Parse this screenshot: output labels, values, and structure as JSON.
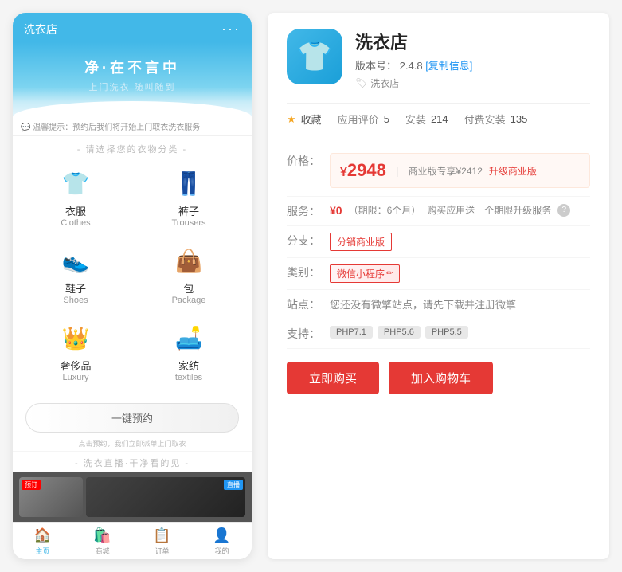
{
  "phone": {
    "title": "洗衣店",
    "dots": "···",
    "banner": {
      "tagline_main": "净·在不言中",
      "tagline_sub": "上门洗衣 随叫随到"
    },
    "notice": "💬 温馨提示：预约后我们将开始上门取衣洗衣服务",
    "section_categories": "- 请选择您的衣物分类 -",
    "categories": [
      {
        "cn": "衣服",
        "en": "Clothes",
        "icon": "👕"
      },
      {
        "cn": "裤子",
        "en": "Trousers",
        "icon": "👖"
      },
      {
        "cn": "鞋子",
        "en": "Shoes",
        "icon": "👟"
      },
      {
        "cn": "包",
        "en": "Package",
        "icon": "👜"
      },
      {
        "cn": "奢侈品",
        "en": "Luxury",
        "icon": "👑"
      },
      {
        "cn": "家纺",
        "en": "textiles",
        "icon": "🛋️"
      }
    ],
    "book_button": "一键预约",
    "book_sub": "点击预约，我们立即派单上门取衣",
    "section_live": "- 洗衣直播·干净看的见 -",
    "live_badge1": "预订",
    "live_badge2": "直播",
    "tabbar": [
      {
        "label": "主页",
        "icon": "🏠",
        "active": true
      },
      {
        "label": "商城",
        "icon": "🛍️"
      },
      {
        "label": "订单",
        "icon": "📋"
      },
      {
        "label": "我的",
        "icon": "👤"
      }
    ]
  },
  "detail": {
    "app_name": "洗衣店",
    "version_label": "版本号：",
    "version": "2.4.8",
    "copy_info": "[复制信息]",
    "tag_icon": "🏷",
    "tag": "洗衣店",
    "stats": {
      "collect_label": "★ 收藏",
      "review_label": "应用评价",
      "review_count": "5",
      "install_label": "安装",
      "install_count": "214",
      "paid_label": "付费安装",
      "paid_count": "135"
    },
    "rows": {
      "price_label": "价格：",
      "price_symbol": "¥",
      "price_value": "2948",
      "price_vip": "商业版专享¥2412",
      "price_upgrade": "升级商业版",
      "service_label": "服务：",
      "service_free": "¥0",
      "service_period": "（期限：6个月）",
      "service_upgrade": "购买应用送一个期限升级服务",
      "branch_label": "分支：",
      "branch_tag": "分销商业版",
      "category_label": "类别：",
      "category_tag": "微信小程序",
      "site_label": "站点：",
      "site_text": "您还没有微擎站点，请先下载并注册微擎",
      "support_label": "支持：",
      "php_versions": [
        "PHP7.1",
        "PHP5.6",
        "PHP5.5"
      ]
    },
    "buttons": {
      "buy": "立即购买",
      "cart": "加入购物车"
    }
  }
}
